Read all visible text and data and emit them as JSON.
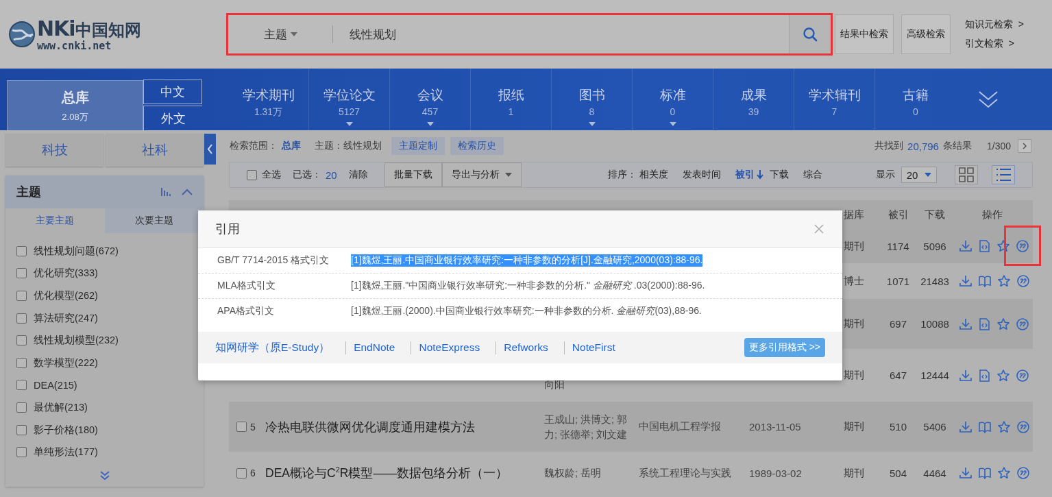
{
  "header": {
    "logo": {
      "mark": "NKi",
      "name": "中国知网",
      "subtitle": "www.cnki.net"
    },
    "search": {
      "field_type": "主题",
      "query": "线性规划",
      "annotated": true
    },
    "buttons": [
      "结果中检索",
      "高级检索"
    ],
    "links": [
      {
        "label": "知识元检索",
        "arrow": ">"
      },
      {
        "label": "引文检索",
        "arrow": ">"
      }
    ]
  },
  "nav": {
    "main": {
      "label": "总库",
      "count": "2.08万"
    },
    "lang_tabs": [
      "中文",
      "外文"
    ],
    "databases": [
      {
        "label": "学术期刊",
        "count": "1.31万",
        "expandable": false
      },
      {
        "label": "学位论文",
        "count": "5127",
        "expandable": true
      },
      {
        "label": "会议",
        "count": "457",
        "expandable": true
      },
      {
        "label": "报纸",
        "count": "1",
        "expandable": false
      },
      {
        "label": "图书",
        "count": "8",
        "expandable": true
      },
      {
        "label": "标准",
        "count": "0",
        "expandable": true
      },
      {
        "label": "成果",
        "count": "39",
        "expandable": false
      },
      {
        "label": "学术辑刊",
        "count": "7",
        "expandable": false
      },
      {
        "label": "古籍",
        "count": "0",
        "expandable": false
      }
    ]
  },
  "sidebar": {
    "categories": [
      "科技",
      "社科"
    ],
    "facet": {
      "title": "主题",
      "tabs": [
        {
          "label": "主要主题",
          "selected": true
        },
        {
          "label": "次要主题",
          "selected": false
        }
      ],
      "items": [
        {
          "label": "线性规划问题(672)",
          "checked": false
        },
        {
          "label": "优化研究(333)",
          "checked": false
        },
        {
          "label": "优化模型(262)",
          "checked": false
        },
        {
          "label": "算法研究(247)",
          "checked": false
        },
        {
          "label": "线性规划模型(232)",
          "checked": false
        },
        {
          "label": "数学模型(222)",
          "checked": false
        },
        {
          "label": "DEA(215)",
          "checked": false
        },
        {
          "label": "最优解(213)",
          "checked": false
        },
        {
          "label": "影子价格(180)",
          "checked": false
        },
        {
          "label": "单纯形法(177)",
          "checked": false
        }
      ]
    }
  },
  "results": {
    "scope_label": "检索范围：",
    "scope": "总库",
    "topic": "主题：线性规划",
    "buttons": [
      "主题定制",
      "检索历史"
    ],
    "total_prefix": "共找到",
    "total": "20,796",
    "total_suffix": "条结果",
    "page": "1/300"
  },
  "toolbar": {
    "select_all": {
      "label": "全选",
      "checked": false
    },
    "selected_label": "已选：",
    "selected_count": "20",
    "clear": "清除",
    "buttons": [
      {
        "label": "批量下载",
        "dropdown": false
      },
      {
        "label": "导出与分析",
        "dropdown": true
      }
    ],
    "sort_label": "排序：",
    "sort_options": [
      {
        "label": "相关度",
        "selected": false
      },
      {
        "label": "发表时间",
        "selected": false
      },
      {
        "label": "被引",
        "selected": true
      },
      {
        "label": "下载",
        "selected": false
      },
      {
        "label": "综合",
        "selected": false
      }
    ],
    "display_label": "显示",
    "display_value": "20",
    "views": [
      {
        "kind": "grid",
        "selected": false
      },
      {
        "kind": "list",
        "selected": true
      }
    ]
  },
  "table": {
    "columns": [
      "据库",
      "被引",
      "下载",
      "操作"
    ],
    "rows": [
      {
        "database": "期刊",
        "cited": "1174",
        "downloads": "5096",
        "kind": "html",
        "annotated": true
      },
      {
        "database": "博士",
        "cited": "1071",
        "downloads": "21483",
        "kind": "book",
        "annotated": false
      },
      {
        "database": "期刊",
        "cited": "697",
        "downloads": "10088",
        "kind": "html",
        "annotated": false
      },
      {
        "authors": "向阳",
        "database": "期刊",
        "cited": "647",
        "downloads": "12444",
        "kind": "html",
        "annotated": false
      },
      {
        "checked": false,
        "number": "5",
        "title": "冷热电联供微网优化调度通用建模方法",
        "authors": "王成山; 洪博文; 郭力; 张德举; 刘文建",
        "source": "中国电机工程学报",
        "date": "2013-11-05",
        "database": "期刊",
        "cited": "510",
        "downloads": "5406",
        "kind": "book",
        "annotated": false
      },
      {
        "checked": false,
        "number": "6",
        "title": "DEA概论与C$^{2}$R模型——数据包络分析（一）",
        "authors": "魏权龄; 岳明",
        "source": "系统工程理论与实践",
        "date": "1989-03-02",
        "database": "期刊",
        "cited": "504",
        "downloads": "4464",
        "kind": "book",
        "annotated": false
      }
    ]
  },
  "dialog": {
    "title": "引用",
    "citations": [
      {
        "format": "GB/T 7714-2015 格式引文",
        "text": "[1]魏煜,王丽.中国商业银行效率研究:一种非参数的分析[J].金融研究,2000(03):88-96.",
        "highlighted": true
      },
      {
        "format": "MLA格式引文",
        "text": "[1]魏煜,王丽.\"中国商业银行效率研究:一种非参数的分析.\" *金融研究* .03(2000):88-96.",
        "highlighted": false
      },
      {
        "format": "APA格式引文",
        "text": "[1]魏煜,王丽.(2000).中国商业银行效率研究:一种非参数的分析. *金融研究*(03),88-96.",
        "highlighted": false
      }
    ],
    "tools": [
      "知网研学（原E-Study）",
      "EndNote",
      "NoteExpress",
      "Refworks",
      "NoteFirst"
    ],
    "more_button": "更多引用格式 >>"
  }
}
